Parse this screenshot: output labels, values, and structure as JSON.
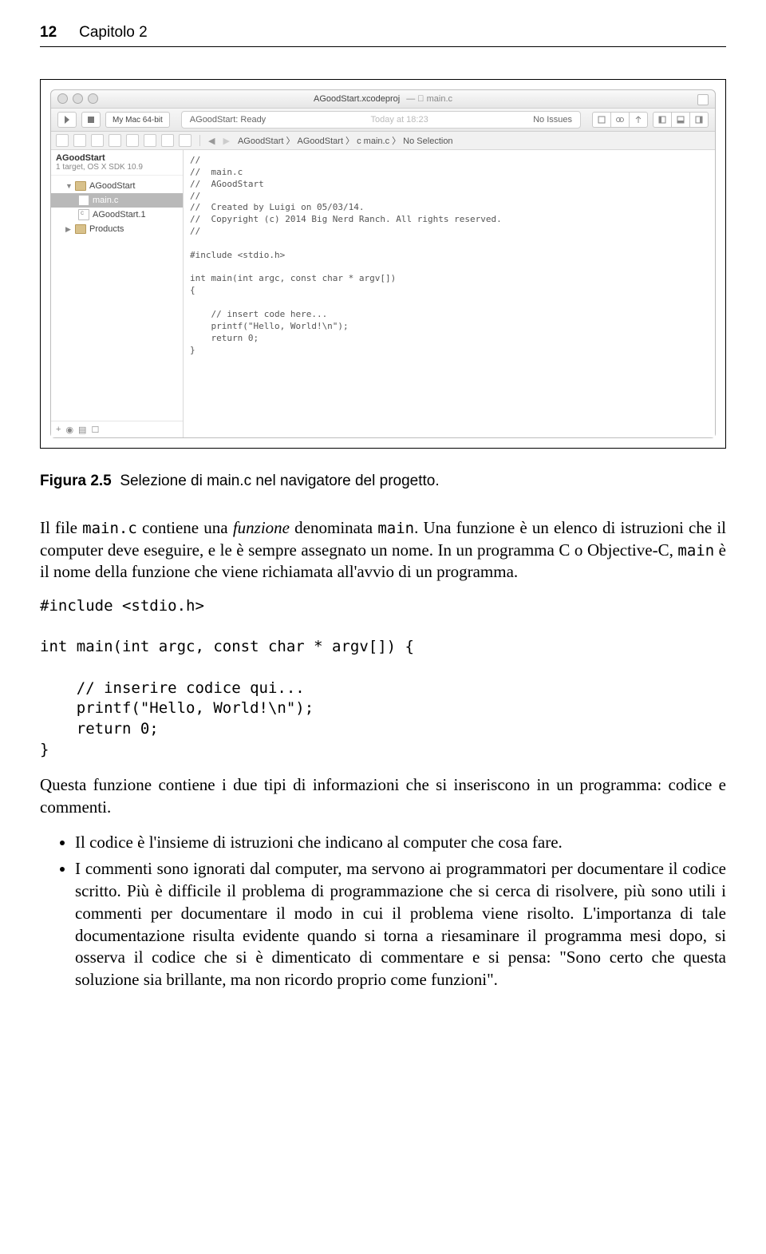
{
  "page": {
    "number": "12",
    "chapter": "Capitolo 2"
  },
  "xcode": {
    "title": "AGoodStart.xcodeproj",
    "title_sub": "— 󰈙 main.c",
    "run_label": "▶",
    "stop_label": "■",
    "scheme": "My Mac 64-bit",
    "status_left": "AGoodStart: Ready",
    "status_mid": "Today at 18:23",
    "status_right": "No Issues",
    "crumb": "AGoodStart 〉 AGoodStart 〉 c main.c 〉 No Selection",
    "project": {
      "name": "AGoodStart",
      "sub": "1 target, OS X SDK 10.9"
    },
    "tree": {
      "folder": "AGoodStart",
      "file_sel": "main.c",
      "file2": "AGoodStart.1",
      "products": "Products"
    },
    "code": "//\n//  main.c\n//  AGoodStart\n//\n//  Created by Luigi on 05/03/14.\n//  Copyright (c) 2014 Big Nerd Ranch. All rights reserved.\n//\n\n#include <stdio.h>\n\nint main(int argc, const char * argv[])\n{\n\n    // insert code here...\n    printf(\"Hello, World!\\n\");\n    return 0;\n}"
  },
  "caption": {
    "label": "Figura 2.5",
    "text": "Selezione di main.c nel navigatore del progetto."
  },
  "para1_a": "Il file ",
  "para1_mono1": "main.c",
  "para1_b": " contiene una ",
  "para1_em": "funzione",
  "para1_c": " denominata ",
  "para1_mono2": "main",
  "para1_d": ". Una funzione è un elenco di istruzioni che il computer deve eseguire, e le è sempre assegnato un nome. In un programma C o Objective-C, ",
  "para1_mono3": "main",
  "para1_e": " è il nome della funzione che viene richiamata all'avvio di un programma.",
  "codeblock": "#include <stdio.h>\n\nint main(int argc, const char * argv[]) {\n\n    // inserire codice qui...\n    printf(\"Hello, World!\\n\");\n    return 0;\n}",
  "para2": "Questa funzione contiene i due tipi di informazioni che si inseriscono in un programma: codice e commenti.",
  "bullet1": "Il codice è l'insieme di istruzioni che indicano al computer che cosa fare.",
  "bullet2": "I commenti sono ignorati dal computer, ma servono ai programmatori per documentare il codice scritto. Più è difficile il problema di programmazione che si cerca di risolvere, più sono utili i commenti per documentare il modo in cui il problema viene risolto. L'importanza di tale documentazione risulta evidente quando si torna a riesaminare il programma mesi dopo, si osserva il codice che si è dimenticato di commentare e si pensa: \"Sono certo che questa soluzione sia brillante, ma non ricordo proprio come funzioni\"."
}
